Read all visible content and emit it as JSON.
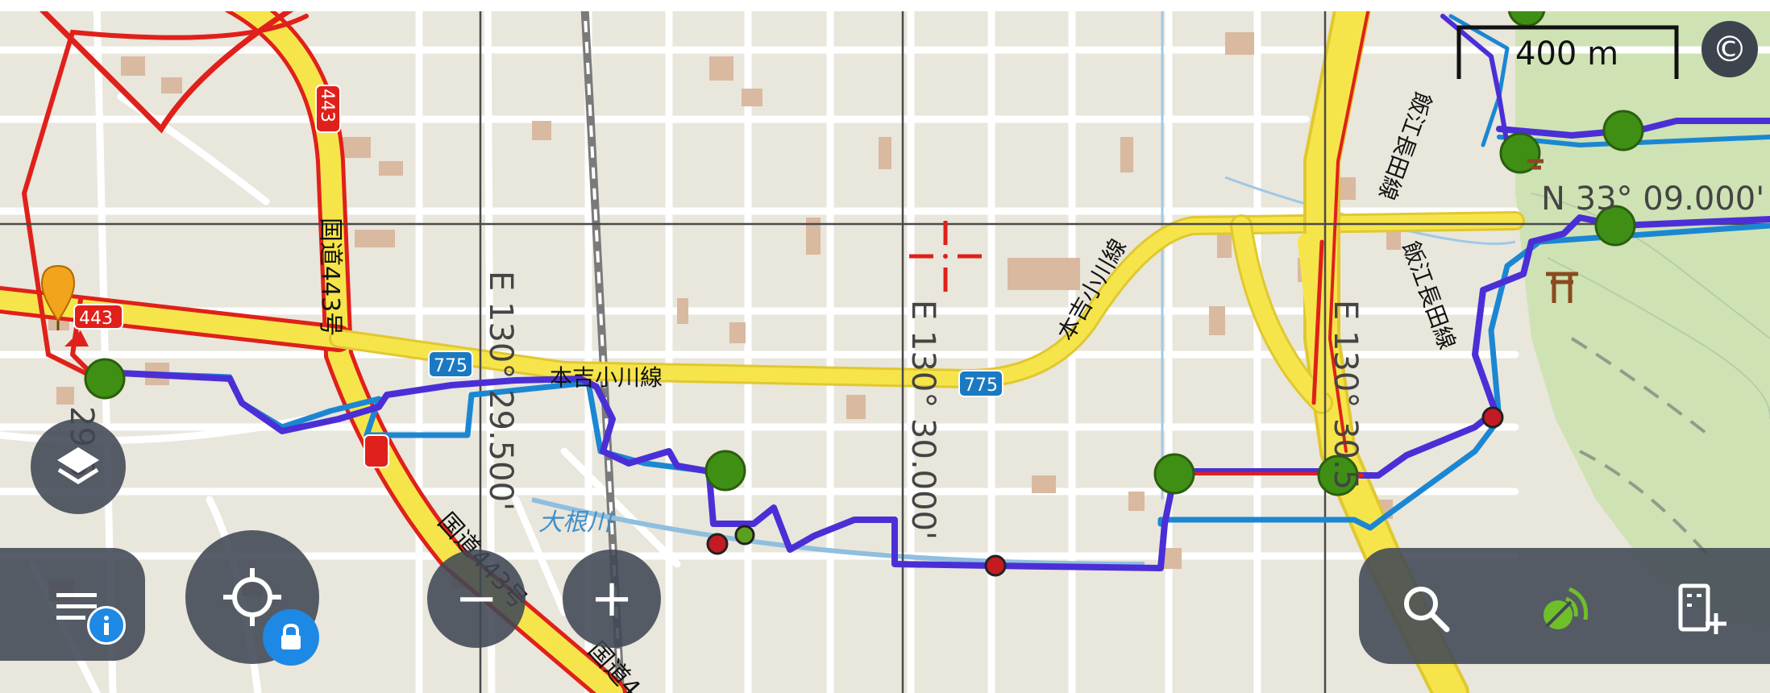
{
  "map": {
    "scale_label": "400 m",
    "copyright_symbol": "©",
    "grid_labels": {
      "lat_label": "N 33° 09.000'",
      "lon_label_1": "E 130° 29.500'",
      "lon_label_2": "E 130° 30.000'",
      "lon_label_3": "E 130° 30.5",
      "lat_label_left": "29.5"
    },
    "road_labels": {
      "route443_v": "国道443号",
      "route443_shield": "443",
      "route443_lower": "国道443号",
      "route443_bottom": "国道4",
      "route775_a": "775",
      "route775_b": "775",
      "line_motoyoshi_a": "本吉小川線",
      "line_motoyoshi_b": "本吉小川線",
      "line_iiechoda_a": "飯江長田線",
      "line_iiechoda_b": "飯江長田線",
      "river": "大根川",
      "shield_433": "443"
    }
  },
  "controls": {
    "menu_icon": "menu-icon",
    "info_icon": "info-icon",
    "locate_icon": "crosshair-locate-icon",
    "lock_icon": "lock-icon",
    "zoom_out_label": "−",
    "zoom_in_label": "+",
    "layers_icon": "layers-icon",
    "search_icon": "search-icon",
    "gps_icon": "gps-signal-icon",
    "add_panel_icon": "add-panel-icon"
  },
  "colors": {
    "track_purple": "#4b2fd6",
    "track_blue": "#1b87d2",
    "route_red": "#e0201a",
    "road_yellow": "#f6e54a",
    "waypoint_green": "#3f8f15",
    "waypoint_red": "#c41a22",
    "accent_blue": "#1e88e5"
  }
}
